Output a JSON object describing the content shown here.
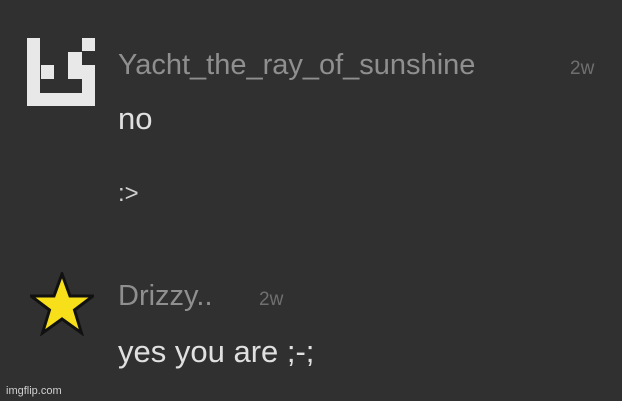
{
  "comments": [
    {
      "username": "Yacht_the_ray_of_sunshine",
      "timestamp": "2w",
      "avatar_icon": "pixel-block-icon",
      "lines": [
        "no",
        ":>"
      ]
    },
    {
      "username": "Drizzy..",
      "timestamp": "2w",
      "avatar_icon": "star-icon",
      "lines": [
        "yes you are ;-;"
      ]
    }
  ],
  "colors": {
    "background": "#303030",
    "username": "#8f8f8f",
    "timestamp": "#6f6f6f",
    "text": "#e0e0e0",
    "star_fill": "#f7e01a",
    "pixel_avatar": "#e8e8e8"
  },
  "watermark": "imgflip.com"
}
